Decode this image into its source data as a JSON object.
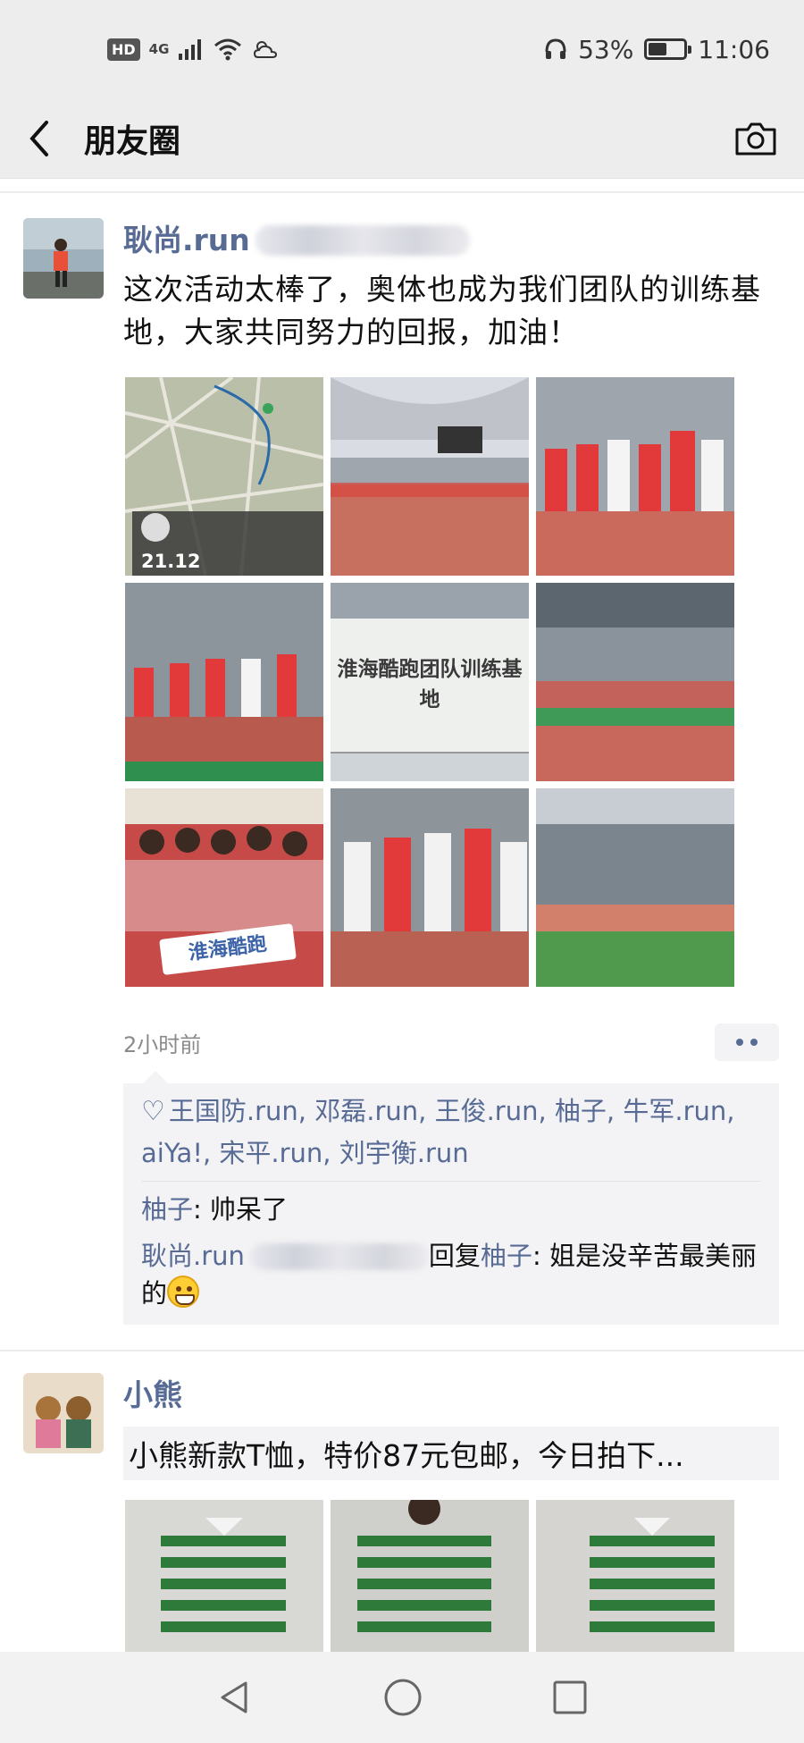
{
  "status_bar": {
    "left_badge": "HD",
    "network": "4G",
    "headphone_icon": "headphone-icon",
    "battery_percent": "53%",
    "battery_level": 0.53,
    "time": "11:06"
  },
  "nav": {
    "title": "朋友圈",
    "back_icon": "chevron-left-icon",
    "camera_icon": "camera-icon"
  },
  "posts": [
    {
      "username": "耿尚.run",
      "text": "这次活动太棒了，奥体也成为我们团队的训练基地，大家共同努力的回报，加油！",
      "photo_captions": [
        "21.12",
        "淮海酷跑团队训练基地",
        "淮海酷跑"
      ],
      "time": "2小时前",
      "likes": "王国防.run, 邓磊.run, 王俊.run, 柚子, 牛军.run, aiYa!, 宋平.run, 刘宇衡.run",
      "comments": [
        {
          "name": "柚子",
          "sep": ": ",
          "text": "帅呆了"
        },
        {
          "name": "耿尚.run",
          "reply_word": "回复",
          "reply_to": "柚子",
          "sep": ": ",
          "text": "姐是没辛苦最美丽的"
        }
      ]
    },
    {
      "username": "小熊",
      "text": "小熊新款T恤，特价87元包邮，今日拍下..."
    }
  ],
  "colors": {
    "link": "#576b95",
    "header_bg": "#ededed",
    "panel_bg": "#f3f3f5"
  }
}
